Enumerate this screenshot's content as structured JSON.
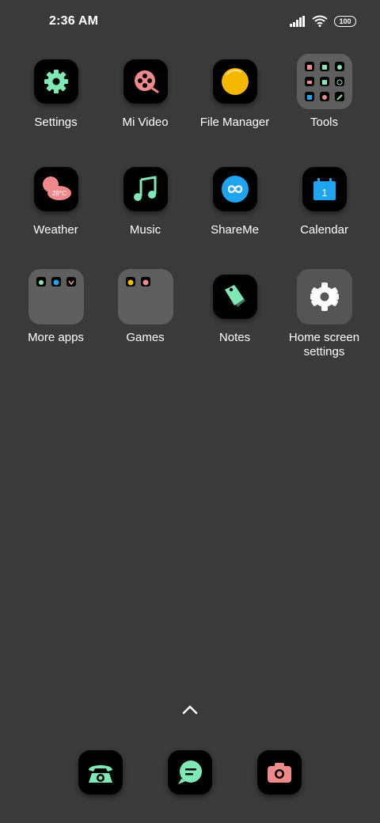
{
  "status": {
    "time": "2:36 AM",
    "battery": "100"
  },
  "apps": [
    {
      "label": "Settings"
    },
    {
      "label": "Mi Video"
    },
    {
      "label": "File Manager"
    },
    {
      "label": "Tools"
    },
    {
      "label": "Weather",
      "temp": "28°C"
    },
    {
      "label": "Music"
    },
    {
      "label": "ShareMe"
    },
    {
      "label": "Calendar",
      "day": "1"
    },
    {
      "label": "More apps"
    },
    {
      "label": "Games"
    },
    {
      "label": "Notes"
    },
    {
      "label": "Home screen settings"
    }
  ],
  "dock": [
    "phone-icon",
    "messages-icon",
    "camera-icon"
  ],
  "colors": {
    "background": "#3a3a3a",
    "mint": "#7fe8b4",
    "coral": "#f08a8a",
    "amber": "#f5b700",
    "blue": "#1fa4f0"
  }
}
